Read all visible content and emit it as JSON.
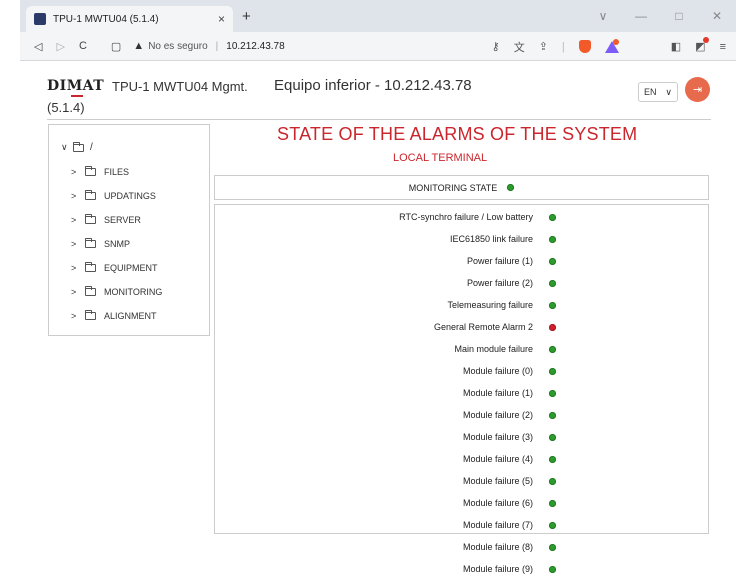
{
  "browser": {
    "tab_title": "TPU-1 MWTU04 (5.1.4)",
    "tab_close": "×",
    "new_tab": "+",
    "win_min": "—",
    "win_max": "□",
    "win_close": "✕",
    "win_down": "∨",
    "security_warning": "No es seguro",
    "url": "10.212.43.78"
  },
  "header": {
    "logo": "DIMAT",
    "app_title": "TPU-1 MWTU04 Mgmt.",
    "app_version": "(5.1.4)",
    "equipo": "Equipo inferior - 10.212.43.78",
    "language": "EN"
  },
  "tree": {
    "root_label": "/",
    "items": [
      {
        "label": "FILES"
      },
      {
        "label": "UPDATINGS"
      },
      {
        "label": "SERVER"
      },
      {
        "label": "SNMP"
      },
      {
        "label": "EQUIPMENT"
      },
      {
        "label": "MONITORING"
      },
      {
        "label": "ALIGNMENT"
      }
    ]
  },
  "main": {
    "title": "STATE OF THE ALARMS OF THE SYSTEM",
    "subtitle": "LOCAL TERMINAL",
    "monitoring_label": "MONITORING STATE",
    "monitoring_status": "ok",
    "alarms": [
      {
        "label": "RTC-synchro failure / Low battery",
        "status": "ok"
      },
      {
        "label": "IEC61850 link failure",
        "status": "ok"
      },
      {
        "label": "Power failure (1)",
        "status": "ok"
      },
      {
        "label": "Power failure (2)",
        "status": "ok"
      },
      {
        "label": "Telemeasuring failure",
        "status": "ok"
      },
      {
        "label": "General Remote Alarm 2",
        "status": "alarm"
      },
      {
        "label": "Main module failure",
        "status": "ok"
      },
      {
        "label": "Module failure (0)",
        "status": "ok"
      },
      {
        "label": "Module failure (1)",
        "status": "ok"
      },
      {
        "label": "Module failure (2)",
        "status": "ok"
      },
      {
        "label": "Module failure (3)",
        "status": "ok"
      },
      {
        "label": "Module failure (4)",
        "status": "ok"
      },
      {
        "label": "Module failure (5)",
        "status": "ok"
      },
      {
        "label": "Module failure (6)",
        "status": "ok"
      },
      {
        "label": "Module failure (7)",
        "status": "ok"
      },
      {
        "label": "Module failure (8)",
        "status": "ok"
      },
      {
        "label": "Module failure (9)",
        "status": "ok"
      }
    ]
  },
  "colors": {
    "accent_red": "#c9272d",
    "status_ok": "#2d9c2d",
    "status_alarm": "#d2202a"
  }
}
